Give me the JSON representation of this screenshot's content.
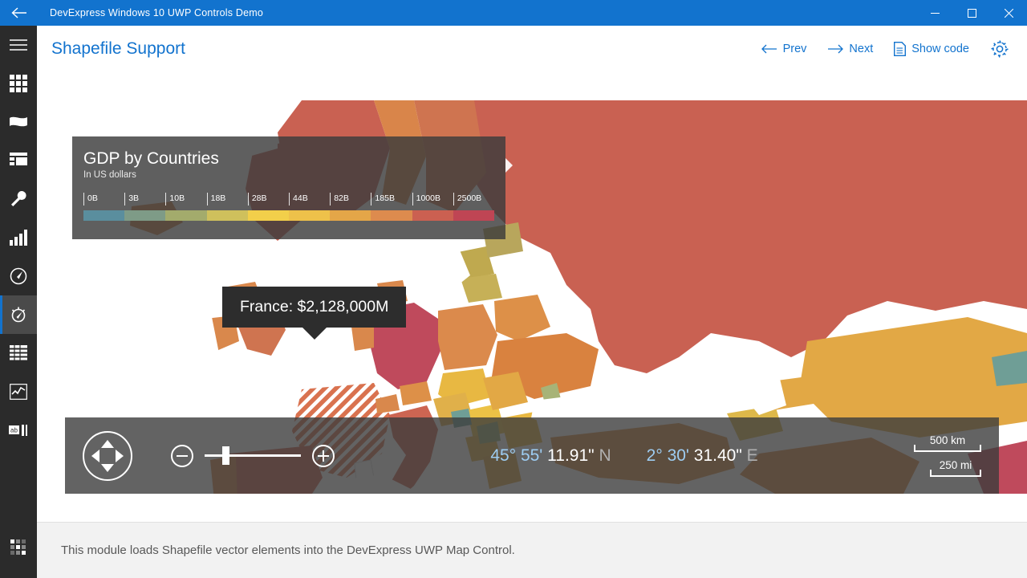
{
  "window": {
    "title": "DevExpress Windows 10 UWP Controls Demo",
    "back_icon": "back-arrow-icon",
    "minimize_label": "─",
    "maximize_label": "☐",
    "close_label": "✕",
    "accent_color": "#1273ce"
  },
  "sidebar": {
    "background": "#2b2b2b",
    "active_color": "#4a4a4a",
    "accent": "#1273ce",
    "items": [
      {
        "icon": "hamburger-menu-icon",
        "name": "menu",
        "active": false
      },
      {
        "icon": "grid-icon",
        "name": "grid",
        "active": false
      },
      {
        "icon": "ribbon-icon",
        "name": "ribbon",
        "active": false
      },
      {
        "icon": "layout-icon",
        "name": "layout",
        "active": false
      },
      {
        "icon": "wrench-icon",
        "name": "editors",
        "active": false
      },
      {
        "icon": "bar-chart-icon",
        "name": "charts",
        "active": false
      },
      {
        "icon": "gauge-icon",
        "name": "gauges",
        "active": false
      },
      {
        "icon": "map-compass-icon",
        "name": "maps",
        "active": true
      },
      {
        "icon": "table-icon",
        "name": "data-grid",
        "active": false
      },
      {
        "icon": "sparkline-icon",
        "name": "sparkline",
        "active": false
      },
      {
        "icon": "text-editor-icon",
        "name": "text-edit",
        "active": false
      },
      {
        "icon": "apps-grid-icon",
        "name": "all-apps",
        "active": false
      }
    ]
  },
  "header": {
    "title": "Shapefile Support",
    "prev_label": "Prev",
    "next_label": "Next",
    "show_code_label": "Show code",
    "prev_icon": "arrow-left-icon",
    "next_icon": "arrow-right-icon",
    "code_icon": "document-icon",
    "settings_icon": "gear-icon",
    "link_color": "#1273ce"
  },
  "legend": {
    "title": "GDP by Countries",
    "subtitle": "In US dollars",
    "ticks": [
      "0B",
      "3B",
      "10B",
      "18B",
      "28B",
      "44B",
      "82B",
      "185B",
      "1000B",
      "2500B"
    ],
    "colors": [
      "#5a8e9e",
      "#7e9b87",
      "#a3ab6c",
      "#cfc05c",
      "#f2cf4a",
      "#eec14a",
      "#e4a648",
      "#dd8b4e",
      "#cb6051",
      "#bf4554"
    ]
  },
  "tooltip": {
    "text": "France: $2,128,000M",
    "country": "France",
    "value": "$2,128,000M"
  },
  "map_toolbar": {
    "pan_icon": "pan-control-icon",
    "zoom_out_icon": "zoom-out-icon",
    "zoom_in_icon": "zoom-in-icon",
    "zoom_slider_value": 18,
    "latitude": {
      "degrees": "45°",
      "minutes": "55'",
      "seconds": "11.91\"",
      "hemisphere": "N"
    },
    "longitude": {
      "degrees": "2°",
      "minutes": "30'",
      "seconds": "31.40\"",
      "hemisphere": "E"
    },
    "scale_km": "500 km",
    "scale_mi": "250 mi"
  },
  "footer": {
    "description": "This module loads Shapefile vector elements into the DevExpress UWP Map Control."
  },
  "chart_data": {
    "type": "map",
    "title": "GDP by Countries",
    "subtitle": "In US dollars",
    "unit": "US dollars",
    "legend_breaks": [
      0,
      3,
      10,
      18,
      28,
      44,
      82,
      185,
      1000,
      2500
    ],
    "legend_break_labels": [
      "0B",
      "3B",
      "10B",
      "18B",
      "28B",
      "44B",
      "82B",
      "185B",
      "1000B",
      "2500B"
    ],
    "legend_colors": [
      "#5a8e9e",
      "#7e9b87",
      "#a3ab6c",
      "#cfc05c",
      "#f2cf4a",
      "#eec14a",
      "#e4a648",
      "#dd8b4e",
      "#cb6051",
      "#bf4554"
    ],
    "selected_feature": {
      "name": "France",
      "value_label": "$2,128,000M",
      "value": 2128000
    },
    "center": {
      "lat": "45° 55' 11.91\" N",
      "lon": "2° 30' 31.40\" E"
    },
    "scalebars": [
      "500 km",
      "250 mi"
    ]
  }
}
